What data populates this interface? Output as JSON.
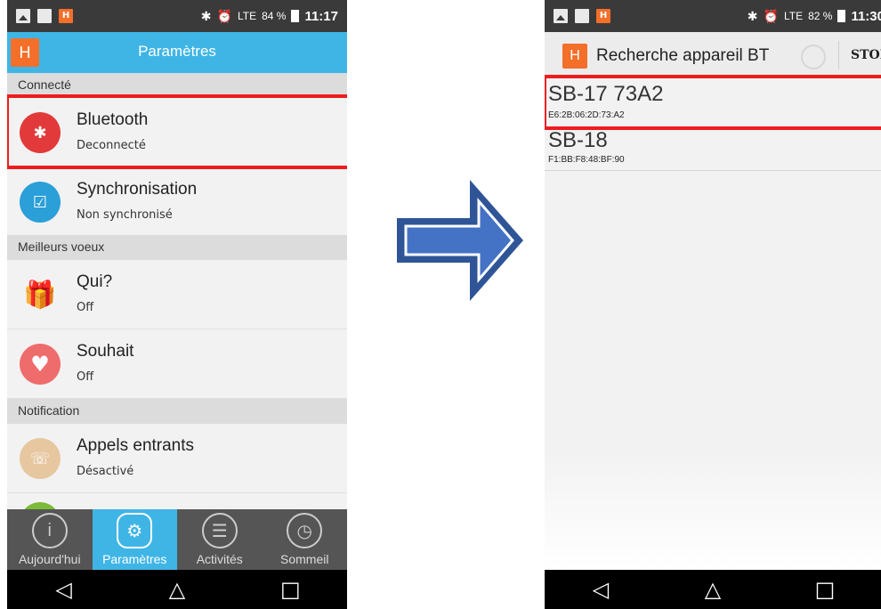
{
  "left": {
    "status": {
      "percent": "84 %",
      "time": "11:17",
      "network": "LTE"
    },
    "appbar": {
      "logo": "H",
      "title": "Paramètres"
    },
    "sections": [
      {
        "header": "Connecté",
        "items": [
          {
            "label": "Bluetooth",
            "sub": "Deconnecté",
            "icon": "bluetooth-icon",
            "color": "#e23a3a",
            "glyph": "✱"
          },
          {
            "label": "Synchronisation",
            "sub": "Non synchronisé",
            "icon": "sync-icon",
            "color": "#2a9fd8",
            "glyph": "☑"
          }
        ]
      },
      {
        "header": "Meilleurs voeux",
        "items": [
          {
            "label": "Qui?",
            "sub": "Off",
            "icon": "gift-icon",
            "color": "#f28b8b",
            "glyph": "🎁"
          },
          {
            "label": "Souhait",
            "sub": "Off",
            "icon": "heart-icon",
            "color": "#ef6c6c",
            "glyph": "♥"
          }
        ]
      },
      {
        "header": "Notification",
        "items": [
          {
            "label": "Appels entrants",
            "sub": "Désactivé",
            "icon": "incoming-call-icon",
            "color": "#e6c7a0",
            "glyph": "☏"
          }
        ]
      }
    ],
    "bottom_nav": [
      {
        "label": "Aujourd'hui",
        "icon": "info-icon",
        "glyph": "i",
        "active": false
      },
      {
        "label": "Paramètres",
        "icon": "settings-gear-icon",
        "glyph": "⚙",
        "active": true
      },
      {
        "label": "Activités",
        "icon": "list-icon",
        "glyph": "☰",
        "active": false
      },
      {
        "label": "Sommeil",
        "icon": "clock-icon",
        "glyph": "◷",
        "active": false
      }
    ]
  },
  "right": {
    "status": {
      "percent": "82 %",
      "time": "11:30",
      "network": "LTE"
    },
    "appbar": {
      "logo": "H",
      "title": "Recherche appareil BT",
      "stop_label": "STOP"
    },
    "devices": [
      {
        "name": "SB-17 73A2",
        "mac": "E6:2B:06:2D:73:A2"
      },
      {
        "name": "SB-18",
        "mac": "F1:BB:F8:48:BF:90"
      }
    ]
  },
  "system_nav": {
    "back": "◁",
    "home": "△",
    "recent": "□"
  },
  "colors": {
    "accent": "#3fb5e6",
    "highlight": "#ee1c1c",
    "arrow": "#4472c4"
  }
}
